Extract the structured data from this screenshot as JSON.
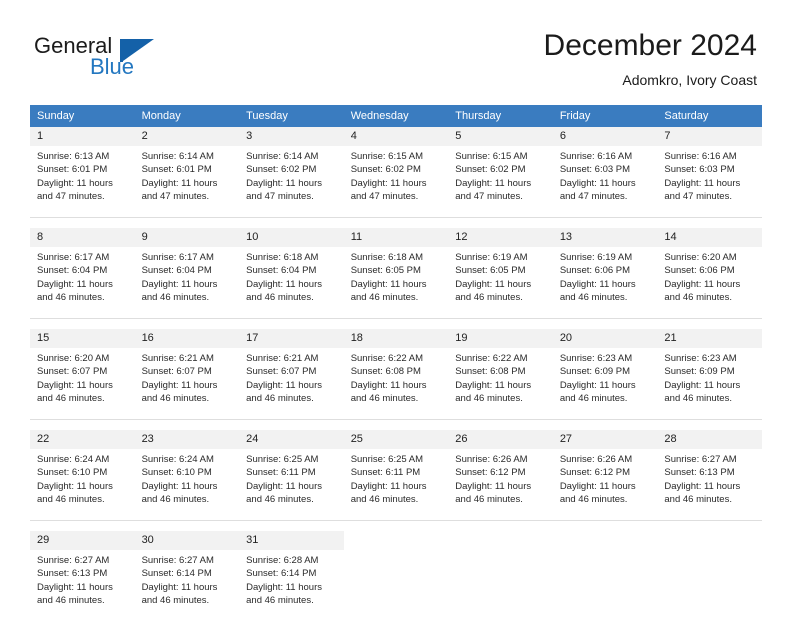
{
  "brand": {
    "name_part1": "General",
    "name_part2": "Blue",
    "flag_icon": "triangle-flag-icon"
  },
  "header": {
    "month_title": "December 2024",
    "location": "Adomkro, Ivory Coast"
  },
  "colors": {
    "header_blue": "#3a7cc0",
    "daynum_band": "#f2f2f2",
    "logo_blue": "#2377c0",
    "flag_blue": "#1461a8",
    "text": "#222222"
  },
  "weekdays": [
    {
      "label": "Sunday"
    },
    {
      "label": "Monday"
    },
    {
      "label": "Tuesday"
    },
    {
      "label": "Wednesday"
    },
    {
      "label": "Thursday"
    },
    {
      "label": "Friday"
    },
    {
      "label": "Saturday"
    }
  ],
  "weeks": [
    [
      {
        "day": "1",
        "sunrise": "Sunrise: 6:13 AM",
        "sunset": "Sunset: 6:01 PM",
        "daylight_line1": "Daylight: 11 hours",
        "daylight_line2": "and 47 minutes."
      },
      {
        "day": "2",
        "sunrise": "Sunrise: 6:14 AM",
        "sunset": "Sunset: 6:01 PM",
        "daylight_line1": "Daylight: 11 hours",
        "daylight_line2": "and 47 minutes."
      },
      {
        "day": "3",
        "sunrise": "Sunrise: 6:14 AM",
        "sunset": "Sunset: 6:02 PM",
        "daylight_line1": "Daylight: 11 hours",
        "daylight_line2": "and 47 minutes."
      },
      {
        "day": "4",
        "sunrise": "Sunrise: 6:15 AM",
        "sunset": "Sunset: 6:02 PM",
        "daylight_line1": "Daylight: 11 hours",
        "daylight_line2": "and 47 minutes."
      },
      {
        "day": "5",
        "sunrise": "Sunrise: 6:15 AM",
        "sunset": "Sunset: 6:02 PM",
        "daylight_line1": "Daylight: 11 hours",
        "daylight_line2": "and 47 minutes."
      },
      {
        "day": "6",
        "sunrise": "Sunrise: 6:16 AM",
        "sunset": "Sunset: 6:03 PM",
        "daylight_line1": "Daylight: 11 hours",
        "daylight_line2": "and 47 minutes."
      },
      {
        "day": "7",
        "sunrise": "Sunrise: 6:16 AM",
        "sunset": "Sunset: 6:03 PM",
        "daylight_line1": "Daylight: 11 hours",
        "daylight_line2": "and 47 minutes."
      }
    ],
    [
      {
        "day": "8",
        "sunrise": "Sunrise: 6:17 AM",
        "sunset": "Sunset: 6:04 PM",
        "daylight_line1": "Daylight: 11 hours",
        "daylight_line2": "and 46 minutes."
      },
      {
        "day": "9",
        "sunrise": "Sunrise: 6:17 AM",
        "sunset": "Sunset: 6:04 PM",
        "daylight_line1": "Daylight: 11 hours",
        "daylight_line2": "and 46 minutes."
      },
      {
        "day": "10",
        "sunrise": "Sunrise: 6:18 AM",
        "sunset": "Sunset: 6:04 PM",
        "daylight_line1": "Daylight: 11 hours",
        "daylight_line2": "and 46 minutes."
      },
      {
        "day": "11",
        "sunrise": "Sunrise: 6:18 AM",
        "sunset": "Sunset: 6:05 PM",
        "daylight_line1": "Daylight: 11 hours",
        "daylight_line2": "and 46 minutes."
      },
      {
        "day": "12",
        "sunrise": "Sunrise: 6:19 AM",
        "sunset": "Sunset: 6:05 PM",
        "daylight_line1": "Daylight: 11 hours",
        "daylight_line2": "and 46 minutes."
      },
      {
        "day": "13",
        "sunrise": "Sunrise: 6:19 AM",
        "sunset": "Sunset: 6:06 PM",
        "daylight_line1": "Daylight: 11 hours",
        "daylight_line2": "and 46 minutes."
      },
      {
        "day": "14",
        "sunrise": "Sunrise: 6:20 AM",
        "sunset": "Sunset: 6:06 PM",
        "daylight_line1": "Daylight: 11 hours",
        "daylight_line2": "and 46 minutes."
      }
    ],
    [
      {
        "day": "15",
        "sunrise": "Sunrise: 6:20 AM",
        "sunset": "Sunset: 6:07 PM",
        "daylight_line1": "Daylight: 11 hours",
        "daylight_line2": "and 46 minutes."
      },
      {
        "day": "16",
        "sunrise": "Sunrise: 6:21 AM",
        "sunset": "Sunset: 6:07 PM",
        "daylight_line1": "Daylight: 11 hours",
        "daylight_line2": "and 46 minutes."
      },
      {
        "day": "17",
        "sunrise": "Sunrise: 6:21 AM",
        "sunset": "Sunset: 6:07 PM",
        "daylight_line1": "Daylight: 11 hours",
        "daylight_line2": "and 46 minutes."
      },
      {
        "day": "18",
        "sunrise": "Sunrise: 6:22 AM",
        "sunset": "Sunset: 6:08 PM",
        "daylight_line1": "Daylight: 11 hours",
        "daylight_line2": "and 46 minutes."
      },
      {
        "day": "19",
        "sunrise": "Sunrise: 6:22 AM",
        "sunset": "Sunset: 6:08 PM",
        "daylight_line1": "Daylight: 11 hours",
        "daylight_line2": "and 46 minutes."
      },
      {
        "day": "20",
        "sunrise": "Sunrise: 6:23 AM",
        "sunset": "Sunset: 6:09 PM",
        "daylight_line1": "Daylight: 11 hours",
        "daylight_line2": "and 46 minutes."
      },
      {
        "day": "21",
        "sunrise": "Sunrise: 6:23 AM",
        "sunset": "Sunset: 6:09 PM",
        "daylight_line1": "Daylight: 11 hours",
        "daylight_line2": "and 46 minutes."
      }
    ],
    [
      {
        "day": "22",
        "sunrise": "Sunrise: 6:24 AM",
        "sunset": "Sunset: 6:10 PM",
        "daylight_line1": "Daylight: 11 hours",
        "daylight_line2": "and 46 minutes."
      },
      {
        "day": "23",
        "sunrise": "Sunrise: 6:24 AM",
        "sunset": "Sunset: 6:10 PM",
        "daylight_line1": "Daylight: 11 hours",
        "daylight_line2": "and 46 minutes."
      },
      {
        "day": "24",
        "sunrise": "Sunrise: 6:25 AM",
        "sunset": "Sunset: 6:11 PM",
        "daylight_line1": "Daylight: 11 hours",
        "daylight_line2": "and 46 minutes."
      },
      {
        "day": "25",
        "sunrise": "Sunrise: 6:25 AM",
        "sunset": "Sunset: 6:11 PM",
        "daylight_line1": "Daylight: 11 hours",
        "daylight_line2": "and 46 minutes."
      },
      {
        "day": "26",
        "sunrise": "Sunrise: 6:26 AM",
        "sunset": "Sunset: 6:12 PM",
        "daylight_line1": "Daylight: 11 hours",
        "daylight_line2": "and 46 minutes."
      },
      {
        "day": "27",
        "sunrise": "Sunrise: 6:26 AM",
        "sunset": "Sunset: 6:12 PM",
        "daylight_line1": "Daylight: 11 hours",
        "daylight_line2": "and 46 minutes."
      },
      {
        "day": "28",
        "sunrise": "Sunrise: 6:27 AM",
        "sunset": "Sunset: 6:13 PM",
        "daylight_line1": "Daylight: 11 hours",
        "daylight_line2": "and 46 minutes."
      }
    ],
    [
      {
        "day": "29",
        "sunrise": "Sunrise: 6:27 AM",
        "sunset": "Sunset: 6:13 PM",
        "daylight_line1": "Daylight: 11 hours",
        "daylight_line2": "and 46 minutes."
      },
      {
        "day": "30",
        "sunrise": "Sunrise: 6:27 AM",
        "sunset": "Sunset: 6:14 PM",
        "daylight_line1": "Daylight: 11 hours",
        "daylight_line2": "and 46 minutes."
      },
      {
        "day": "31",
        "sunrise": "Sunrise: 6:28 AM",
        "sunset": "Sunset: 6:14 PM",
        "daylight_line1": "Daylight: 11 hours",
        "daylight_line2": "and 46 minutes."
      },
      {
        "day": "",
        "sunrise": "",
        "sunset": "",
        "daylight_line1": "",
        "daylight_line2": ""
      },
      {
        "day": "",
        "sunrise": "",
        "sunset": "",
        "daylight_line1": "",
        "daylight_line2": ""
      },
      {
        "day": "",
        "sunrise": "",
        "sunset": "",
        "daylight_line1": "",
        "daylight_line2": ""
      },
      {
        "day": "",
        "sunrise": "",
        "sunset": "",
        "daylight_line1": "",
        "daylight_line2": ""
      }
    ]
  ]
}
